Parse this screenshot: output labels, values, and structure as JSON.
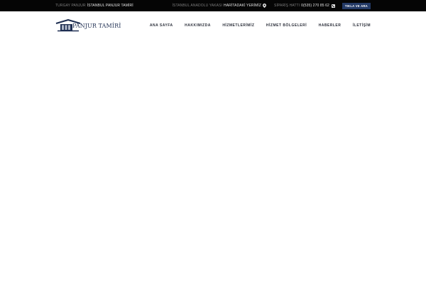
{
  "topbar": {
    "brand_prefix": "TURGAY PANJUR",
    "brand_title": "İSTANBUL PANJUR TAMİRİ",
    "location_prefix": "İSTANBUL ANADOLU YAKASI",
    "location_link": "HARİTADAKİ YERİMİZ",
    "phone_prefix": "SİPARİŞ HATTI",
    "phone_number": "0(535) 270 85 62",
    "call_button": "TIKLA VE ARA"
  },
  "header": {
    "logo_text": "PANJUR TAMİRİ"
  },
  "nav": {
    "items": [
      "ANA SAYFA",
      "HAKKIMIZDA",
      "HİZMETLERİMİZ",
      "HİZMET BÖLGELERİ",
      "HABERLER",
      "İLETİŞİM"
    ]
  },
  "colors": {
    "topbar_bg": "#050505",
    "accent": "#243a66",
    "logo_navy": "#1f2f52"
  }
}
